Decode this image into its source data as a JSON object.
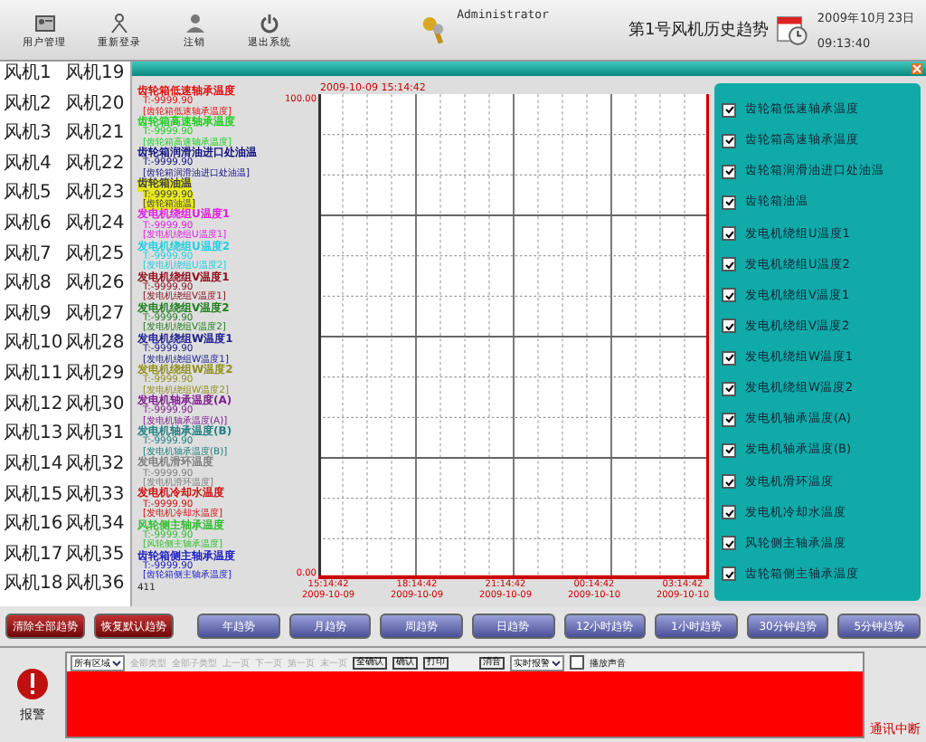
{
  "toolbar": [
    {
      "kind": "users",
      "label": "用户管理"
    },
    {
      "kind": "relogin",
      "label": "重新登录"
    },
    {
      "kind": "logout",
      "label": "注销"
    },
    {
      "kind": "exit",
      "label": "退出系统"
    }
  ],
  "user": "Administrator",
  "title": "第1号风机历史趋势",
  "date": "2009年10月23日",
  "time": "09:13:40",
  "turbines": [
    "风机1",
    "风机2",
    "风机3",
    "风机4",
    "风机5",
    "风机6",
    "风机7",
    "风机8",
    "风机9",
    "风机10",
    "风机11",
    "风机12",
    "风机13",
    "风机14",
    "风机15",
    "风机16",
    "风机17",
    "风机18",
    "风机19",
    "风机20",
    "风机21",
    "风机22",
    "风机23",
    "风机24",
    "风机25",
    "风机26",
    "风机27",
    "风机28",
    "风机29",
    "风机30",
    "风机31",
    "风机32",
    "风机33",
    "风机34",
    "风机35",
    "风机36"
  ],
  "legend": [
    {
      "name": "齿轮箱低速轴承温度",
      "value": "T:-9999.90",
      "tag": "[齿轮箱低速轴承温度]",
      "color": "#e01010",
      "selected": false
    },
    {
      "name": "齿轮箱高速轴承温度",
      "value": "T:-9999.90",
      "tag": "[齿轮箱高速轴承温度]",
      "color": "#20d020",
      "selected": false
    },
    {
      "name": "齿轮箱润滑油进口处油温",
      "value": "T:-9999.90",
      "tag": "[齿轮箱润滑油进口处油温]",
      "color": "#101080",
      "selected": false
    },
    {
      "name": "齿轮箱油温",
      "value": "T:-9999.90",
      "tag": "[齿轮箱油温]",
      "color": "#e8e820",
      "selected": true
    },
    {
      "name": "发电机绕组U温度1",
      "value": "T:-9999.90",
      "tag": "[发电机绕组U温度1]",
      "color": "#e020e0",
      "selected": false
    },
    {
      "name": "发电机绕组U温度2",
      "value": "T:-9999.90",
      "tag": "[发电机绕组U温度2]",
      "color": "#20d0e0",
      "selected": false
    },
    {
      "name": "发电机绕组V温度1",
      "value": "T:-9999.90",
      "tag": "[发电机绕组V温度1]",
      "color": "#901020",
      "selected": false
    },
    {
      "name": "发电机绕组V温度2",
      "value": "T:-9999.90",
      "tag": "[发电机绕组V温度2]",
      "color": "#208020",
      "selected": false
    },
    {
      "name": "发电机绕组W温度1",
      "value": "T:-9999.90",
      "tag": "[发电机绕组W温度1]",
      "color": "#202090",
      "selected": false
    },
    {
      "name": "发电机绕组W温度2",
      "value": "T:-9999.90",
      "tag": "[发电机绕组W温度2]",
      "color": "#909020",
      "selected": false
    },
    {
      "name": "发电机轴承温度(A)",
      "value": "T:-9999.90",
      "tag": "[发电机轴承温度(A)]",
      "color": "#802090",
      "selected": false
    },
    {
      "name": "发电机轴承温度(B)",
      "value": "T:-9999.90",
      "tag": "[发电机轴承温度(B)]",
      "color": "#208080",
      "selected": false
    },
    {
      "name": "发电机滑环温度",
      "value": "T:-9999.90",
      "tag": "[发电机滑环温度]",
      "color": "#808080",
      "selected": false
    },
    {
      "name": "发电机冷却水温度",
      "value": "T:-9999.90",
      "tag": "[发电机冷却水温度]",
      "color": "#d01010",
      "selected": false
    },
    {
      "name": "风轮侧主轴承温度",
      "value": "T:-9999.90",
      "tag": "[风轮侧主轴承温度]",
      "color": "#30c030",
      "selected": false
    },
    {
      "name": "齿轮箱侧主轴承温度",
      "value": "T:-9999.90",
      "tag": "[齿轮箱侧主轴承温度]",
      "color": "#2020c0",
      "selected": false
    }
  ],
  "legend_count": "411",
  "chart": {
    "start": "2009-10-09 15:14:42",
    "y_max": "100.00",
    "y_min": "0.00",
    "x_labels": [
      {
        "time": "15:14:42",
        "date": "2009-10-09"
      },
      {
        "time": "18:14:42",
        "date": "2009-10-09"
      },
      {
        "time": "21:14:42",
        "date": "2009-10-09"
      },
      {
        "time": "00:14:42",
        "date": "2009-10-10"
      },
      {
        "time": "03:14:42",
        "date": "2009-10-10"
      }
    ]
  },
  "channels": [
    {
      "label": "齿轮箱低速轴承温度",
      "checked": true
    },
    {
      "label": "齿轮箱高速轴承温度",
      "checked": true
    },
    {
      "label": "齿轮箱润滑油进口处油温",
      "checked": true
    },
    {
      "label": "齿轮箱油温",
      "checked": true
    },
    {
      "label": "发电机绕组U温度1",
      "checked": true
    },
    {
      "label": "发电机绕组U温度2",
      "checked": true
    },
    {
      "label": "发电机绕组V温度1",
      "checked": true
    },
    {
      "label": "发电机绕组V温度2",
      "checked": true
    },
    {
      "label": "发电机绕组W温度1",
      "checked": true
    },
    {
      "label": "发电机绕组W温度2",
      "checked": true
    },
    {
      "label": "发电机轴承温度(A)",
      "checked": true
    },
    {
      "label": "发电机轴承温度(B)",
      "checked": true
    },
    {
      "label": "发电机滑环温度",
      "checked": true
    },
    {
      "label": "发电机冷却水温度",
      "checked": true
    },
    {
      "label": "风轮侧主轴承温度",
      "checked": true
    },
    {
      "label": "齿轮箱侧主轴承温度",
      "checked": true
    }
  ],
  "trend_buttons": [
    {
      "label": "清除全部趋势",
      "kind": "action"
    },
    {
      "label": "恢复默认趋势",
      "kind": "action"
    },
    {
      "label": "年趋势",
      "kind": "range"
    },
    {
      "label": "月趋势",
      "kind": "range"
    },
    {
      "label": "周趋势",
      "kind": "range"
    },
    {
      "label": "日趋势",
      "kind": "range"
    },
    {
      "label": "12小时趋势",
      "kind": "range"
    },
    {
      "label": "1小时趋势",
      "kind": "range"
    },
    {
      "label": "30分钟趋势",
      "kind": "range"
    },
    {
      "label": "5分钟趋势",
      "kind": "range"
    }
  ],
  "alarm": {
    "label": "报警",
    "area": "所有区域",
    "filters": [
      {
        "label": "全部类型",
        "disabled": true
      },
      {
        "label": "全部子类型",
        "disabled": true
      }
    ],
    "pager": [
      {
        "label": "上一页",
        "disabled": true
      },
      {
        "label": "下一页",
        "disabled": true
      },
      {
        "label": "第一页",
        "disabled": true
      },
      {
        "label": "末一页",
        "disabled": true
      }
    ],
    "buttons": [
      "全确认",
      "确认",
      "打印"
    ],
    "mute": "消音",
    "mode": "实时报警",
    "sound": {
      "label": "播放声音",
      "checked": false
    },
    "status": "通讯中断"
  }
}
